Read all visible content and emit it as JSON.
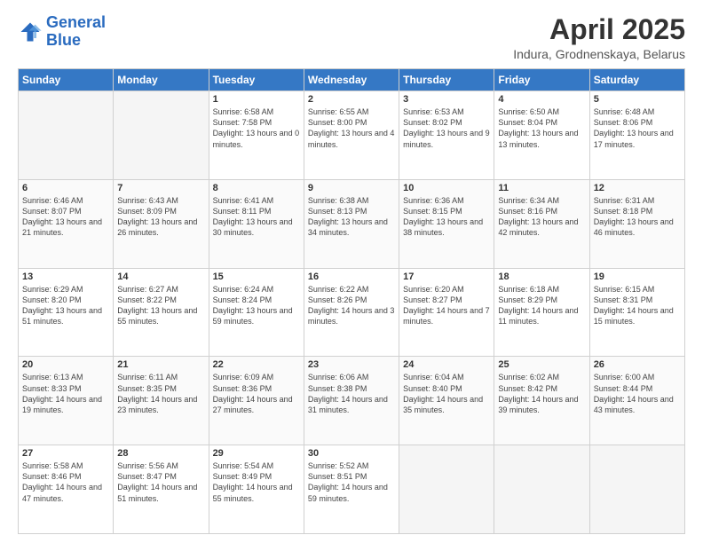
{
  "logo": {
    "line1": "General",
    "line2": "Blue"
  },
  "title": "April 2025",
  "subtitle": "Indura, Grodnenskaya, Belarus",
  "weekdays": [
    "Sunday",
    "Monday",
    "Tuesday",
    "Wednesday",
    "Thursday",
    "Friday",
    "Saturday"
  ],
  "weeks": [
    [
      {
        "day": "",
        "sunrise": "",
        "sunset": "",
        "daylight": ""
      },
      {
        "day": "",
        "sunrise": "",
        "sunset": "",
        "daylight": ""
      },
      {
        "day": "1",
        "sunrise": "Sunrise: 6:58 AM",
        "sunset": "Sunset: 7:58 PM",
        "daylight": "Daylight: 13 hours and 0 minutes."
      },
      {
        "day": "2",
        "sunrise": "Sunrise: 6:55 AM",
        "sunset": "Sunset: 8:00 PM",
        "daylight": "Daylight: 13 hours and 4 minutes."
      },
      {
        "day": "3",
        "sunrise": "Sunrise: 6:53 AM",
        "sunset": "Sunset: 8:02 PM",
        "daylight": "Daylight: 13 hours and 9 minutes."
      },
      {
        "day": "4",
        "sunrise": "Sunrise: 6:50 AM",
        "sunset": "Sunset: 8:04 PM",
        "daylight": "Daylight: 13 hours and 13 minutes."
      },
      {
        "day": "5",
        "sunrise": "Sunrise: 6:48 AM",
        "sunset": "Sunset: 8:06 PM",
        "daylight": "Daylight: 13 hours and 17 minutes."
      }
    ],
    [
      {
        "day": "6",
        "sunrise": "Sunrise: 6:46 AM",
        "sunset": "Sunset: 8:07 PM",
        "daylight": "Daylight: 13 hours and 21 minutes."
      },
      {
        "day": "7",
        "sunrise": "Sunrise: 6:43 AM",
        "sunset": "Sunset: 8:09 PM",
        "daylight": "Daylight: 13 hours and 26 minutes."
      },
      {
        "day": "8",
        "sunrise": "Sunrise: 6:41 AM",
        "sunset": "Sunset: 8:11 PM",
        "daylight": "Daylight: 13 hours and 30 minutes."
      },
      {
        "day": "9",
        "sunrise": "Sunrise: 6:38 AM",
        "sunset": "Sunset: 8:13 PM",
        "daylight": "Daylight: 13 hours and 34 minutes."
      },
      {
        "day": "10",
        "sunrise": "Sunrise: 6:36 AM",
        "sunset": "Sunset: 8:15 PM",
        "daylight": "Daylight: 13 hours and 38 minutes."
      },
      {
        "day": "11",
        "sunrise": "Sunrise: 6:34 AM",
        "sunset": "Sunset: 8:16 PM",
        "daylight": "Daylight: 13 hours and 42 minutes."
      },
      {
        "day": "12",
        "sunrise": "Sunrise: 6:31 AM",
        "sunset": "Sunset: 8:18 PM",
        "daylight": "Daylight: 13 hours and 46 minutes."
      }
    ],
    [
      {
        "day": "13",
        "sunrise": "Sunrise: 6:29 AM",
        "sunset": "Sunset: 8:20 PM",
        "daylight": "Daylight: 13 hours and 51 minutes."
      },
      {
        "day": "14",
        "sunrise": "Sunrise: 6:27 AM",
        "sunset": "Sunset: 8:22 PM",
        "daylight": "Daylight: 13 hours and 55 minutes."
      },
      {
        "day": "15",
        "sunrise": "Sunrise: 6:24 AM",
        "sunset": "Sunset: 8:24 PM",
        "daylight": "Daylight: 13 hours and 59 minutes."
      },
      {
        "day": "16",
        "sunrise": "Sunrise: 6:22 AM",
        "sunset": "Sunset: 8:26 PM",
        "daylight": "Daylight: 14 hours and 3 minutes."
      },
      {
        "day": "17",
        "sunrise": "Sunrise: 6:20 AM",
        "sunset": "Sunset: 8:27 PM",
        "daylight": "Daylight: 14 hours and 7 minutes."
      },
      {
        "day": "18",
        "sunrise": "Sunrise: 6:18 AM",
        "sunset": "Sunset: 8:29 PM",
        "daylight": "Daylight: 14 hours and 11 minutes."
      },
      {
        "day": "19",
        "sunrise": "Sunrise: 6:15 AM",
        "sunset": "Sunset: 8:31 PM",
        "daylight": "Daylight: 14 hours and 15 minutes."
      }
    ],
    [
      {
        "day": "20",
        "sunrise": "Sunrise: 6:13 AM",
        "sunset": "Sunset: 8:33 PM",
        "daylight": "Daylight: 14 hours and 19 minutes."
      },
      {
        "day": "21",
        "sunrise": "Sunrise: 6:11 AM",
        "sunset": "Sunset: 8:35 PM",
        "daylight": "Daylight: 14 hours and 23 minutes."
      },
      {
        "day": "22",
        "sunrise": "Sunrise: 6:09 AM",
        "sunset": "Sunset: 8:36 PM",
        "daylight": "Daylight: 14 hours and 27 minutes."
      },
      {
        "day": "23",
        "sunrise": "Sunrise: 6:06 AM",
        "sunset": "Sunset: 8:38 PM",
        "daylight": "Daylight: 14 hours and 31 minutes."
      },
      {
        "day": "24",
        "sunrise": "Sunrise: 6:04 AM",
        "sunset": "Sunset: 8:40 PM",
        "daylight": "Daylight: 14 hours and 35 minutes."
      },
      {
        "day": "25",
        "sunrise": "Sunrise: 6:02 AM",
        "sunset": "Sunset: 8:42 PM",
        "daylight": "Daylight: 14 hours and 39 minutes."
      },
      {
        "day": "26",
        "sunrise": "Sunrise: 6:00 AM",
        "sunset": "Sunset: 8:44 PM",
        "daylight": "Daylight: 14 hours and 43 minutes."
      }
    ],
    [
      {
        "day": "27",
        "sunrise": "Sunrise: 5:58 AM",
        "sunset": "Sunset: 8:46 PM",
        "daylight": "Daylight: 14 hours and 47 minutes."
      },
      {
        "day": "28",
        "sunrise": "Sunrise: 5:56 AM",
        "sunset": "Sunset: 8:47 PM",
        "daylight": "Daylight: 14 hours and 51 minutes."
      },
      {
        "day": "29",
        "sunrise": "Sunrise: 5:54 AM",
        "sunset": "Sunset: 8:49 PM",
        "daylight": "Daylight: 14 hours and 55 minutes."
      },
      {
        "day": "30",
        "sunrise": "Sunrise: 5:52 AM",
        "sunset": "Sunset: 8:51 PM",
        "daylight": "Daylight: 14 hours and 59 minutes."
      },
      {
        "day": "",
        "sunrise": "",
        "sunset": "",
        "daylight": ""
      },
      {
        "day": "",
        "sunrise": "",
        "sunset": "",
        "daylight": ""
      },
      {
        "day": "",
        "sunrise": "",
        "sunset": "",
        "daylight": ""
      }
    ]
  ]
}
